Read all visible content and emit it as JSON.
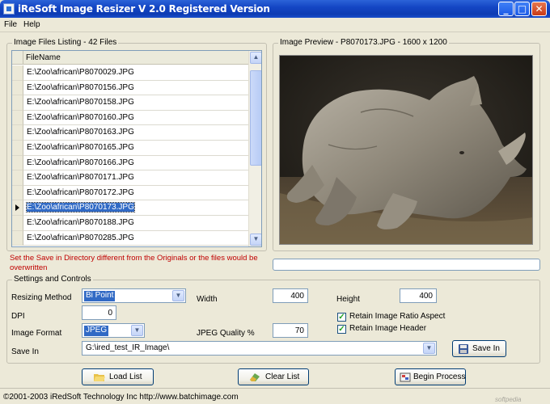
{
  "window": {
    "title": "iReSoft Image Resizer V 2.0 Registered Version",
    "minimize_glyph": "_",
    "maximize_glyph": "□",
    "close_glyph": "✕"
  },
  "menu": {
    "file": "File",
    "help": "Help"
  },
  "file_list": {
    "group_label": "Image Files Listing - 42 Files",
    "column_header": "FileName",
    "files": [
      "E:\\Zoo\\african\\P8070029.JPG",
      "E:\\Zoo\\african\\P8070156.JPG",
      "E:\\Zoo\\african\\P8070158.JPG",
      "E:\\Zoo\\african\\P8070160.JPG",
      "E:\\Zoo\\african\\P8070163.JPG",
      "E:\\Zoo\\african\\P8070165.JPG",
      "E:\\Zoo\\african\\P8070166.JPG",
      "E:\\Zoo\\african\\P8070171.JPG",
      "E:\\Zoo\\african\\P8070172.JPG",
      "E:\\Zoo\\african\\P8070173.JPG",
      "E:\\Zoo\\african\\P8070188.JPG",
      "E:\\Zoo\\african\\P8070285.JPG"
    ],
    "selected_index": 9
  },
  "warning": "Set the Save in Directory different from the Originals or the files would be overwritten",
  "preview": {
    "group_label": "Image Preview - P8070173.JPG - 1600 x 1200"
  },
  "progress": {
    "value": 0
  },
  "settings": {
    "group_label": "Settings and Controls",
    "resizing_method_label": "Resizing Method",
    "resizing_method_value": "Bi Point",
    "width_label": "Width",
    "width_value": "400",
    "height_label": "Height",
    "height_value": "400",
    "dpi_label": "DPI",
    "dpi_value": "0",
    "retain_ratio_label": "Retain Image Ratio Aspect",
    "retain_ratio_checked": true,
    "retain_header_label": "Retain Image Header",
    "retain_header_checked": true,
    "image_format_label": "Image Format",
    "image_format_value": "JPEG",
    "jpeg_quality_label": "JPEG Quality %",
    "jpeg_quality_value": "70",
    "save_in_label": "Save In",
    "save_in_value": "G:\\ired_test_IR_Image\\",
    "save_in_button": "Save In"
  },
  "actions": {
    "load_list": "Load List",
    "clear_list": "Clear List",
    "begin_process": "Begin Process"
  },
  "status": {
    "text": "©2001-2003 iRedSoft Technology Inc http://www.batchimage.com",
    "watermark": "softpedia"
  },
  "icons": {
    "app": "app-icon",
    "save_in": "floppy-disk-icon",
    "load_list": "folder-open-icon",
    "clear_list": "eraser-icon",
    "begin_process": "process-gear-icon"
  }
}
